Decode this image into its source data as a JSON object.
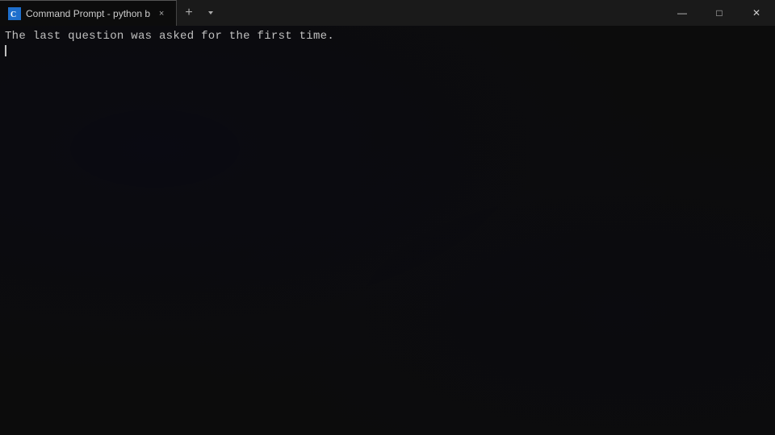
{
  "titlebar": {
    "tab": {
      "label": "Command Prompt - python b",
      "icon_char": "C",
      "close_char": "×"
    },
    "add_button": "+",
    "dropdown_char": "˅",
    "minimize": "—",
    "maximize": "□",
    "close": "✕"
  },
  "terminal": {
    "output_line": "The last question was asked for the first time.",
    "cursor_label": ""
  }
}
